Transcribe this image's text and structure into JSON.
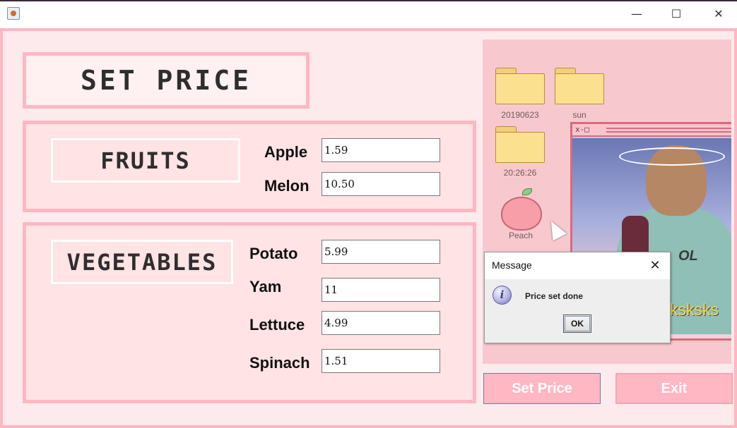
{
  "window": {
    "minimize_glyph": "—",
    "maximize_glyph": "☐",
    "close_glyph": "✕"
  },
  "form": {
    "title": "SET PRICE",
    "fruits": {
      "label": "FRUITS",
      "items": [
        {
          "label": "Apple",
          "value": "1.59"
        },
        {
          "label": "Melon",
          "value": "10.50"
        }
      ]
    },
    "vegetables": {
      "label": "VEGETABLES",
      "items": [
        {
          "label": "Potato",
          "value": "5.99"
        },
        {
          "label": "Yam",
          "value": "11"
        },
        {
          "label": "Lettuce",
          "value": "4.99"
        },
        {
          "label": "Spinach",
          "value": "1.51"
        }
      ]
    }
  },
  "picture": {
    "folders": [
      "20190623",
      "sun",
      "20:26:26"
    ],
    "peach_label": "Peach",
    "window_controls": "x-□",
    "text": "ksksks",
    "shirt_text": "OL"
  },
  "buttons": {
    "set_price": "Set Price",
    "exit": "Exit"
  },
  "dialog": {
    "title": "Message",
    "message": "Price set done",
    "ok": "OK",
    "close_glyph": "✕",
    "icon_glyph": "i"
  },
  "colors": {
    "accent_pink": "#ffb7c3",
    "panel_bg": "#ffe3e5",
    "content_bg": "#fdeaed"
  }
}
